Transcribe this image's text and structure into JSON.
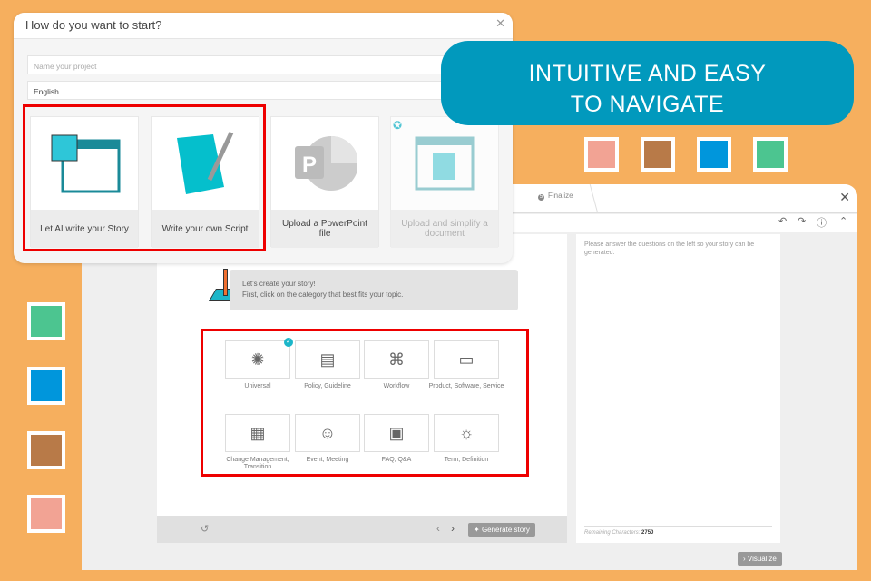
{
  "dialog": {
    "title": "How do you want to start?",
    "name_placeholder": "Name your project",
    "language": "English",
    "cards": [
      {
        "label": "Let AI write your Story"
      },
      {
        "label": "Write your own Script"
      },
      {
        "label": "Upload a PowerPoint file"
      },
      {
        "label": "Upload and simplify a document"
      }
    ]
  },
  "banner": {
    "line1": "INTUITIVE AND EASY",
    "line2": "TO NAVIGATE"
  },
  "swatches": {
    "right": [
      "#F2A394",
      "#B87A48",
      "#0096DC",
      "#4CC590"
    ],
    "left": [
      "#4CC590",
      "#0096DC",
      "#B87A48",
      "#F2A394"
    ]
  },
  "editor": {
    "step_number": "5",
    "step_label": "Finalize",
    "intro_line1": "Let's create your story!",
    "intro_line2": "First, click on the category that best fits your topic.",
    "categories": [
      {
        "label": "Universal",
        "icon": "brain-icon",
        "selected": true
      },
      {
        "label": "Policy, Guideline",
        "icon": "book-icon"
      },
      {
        "label": "Workflow",
        "icon": "flowchart-icon"
      },
      {
        "label": "Product, Software, Service",
        "icon": "storefront-icon"
      },
      {
        "label": "Change Management, Transition",
        "icon": "buildings-icon"
      },
      {
        "label": "Event, Meeting",
        "icon": "people-icon"
      },
      {
        "label": "FAQ, Q&A",
        "icon": "chat-icon"
      },
      {
        "label": "Term, Definition",
        "icon": "lightbulb-icon"
      }
    ],
    "generate_label": "Generate story",
    "right_hint": "Please answer the questions on the left so your story can be generated.",
    "remaining_label": "Remaining Characters:",
    "remaining_value": "2750",
    "visualize_label": "Visualize"
  }
}
